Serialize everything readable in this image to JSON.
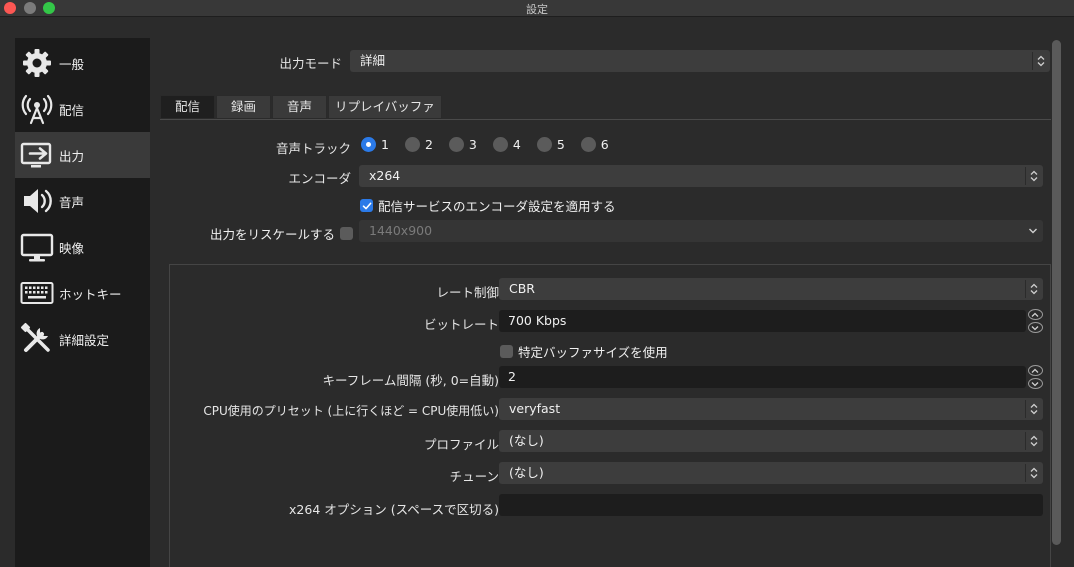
{
  "window": {
    "title": "設定"
  },
  "sidebar": {
    "items": [
      {
        "label": "一般",
        "icon": "gear-icon"
      },
      {
        "label": "配信",
        "icon": "broadcast-antenna-icon"
      },
      {
        "label": "出力",
        "icon": "output-monitor-icon",
        "active": true
      },
      {
        "label": "音声",
        "icon": "speaker-icon"
      },
      {
        "label": "映像",
        "icon": "monitor-icon"
      },
      {
        "label": "ホットキー",
        "icon": "keyboard-icon"
      },
      {
        "label": "詳細設定",
        "icon": "tools-icon"
      }
    ]
  },
  "output_mode": {
    "label": "出力モード",
    "value": "詳細"
  },
  "tabs": [
    {
      "label": "配信",
      "active": true
    },
    {
      "label": "録画"
    },
    {
      "label": "音声"
    },
    {
      "label": "リプレイバッファ"
    }
  ],
  "audio_track": {
    "label": "音声トラック",
    "options": [
      "1",
      "2",
      "3",
      "4",
      "5",
      "6"
    ],
    "selected": "1"
  },
  "encoder": {
    "label": "エンコーダ",
    "value": "x264"
  },
  "apply_service_settings": {
    "label": "配信サービスのエンコーダ設定を適用する",
    "checked": true
  },
  "rescale": {
    "label": "出力をリスケールする",
    "checked": false,
    "value": "1440x900"
  },
  "rate_control": {
    "label": "レート制御",
    "value": "CBR"
  },
  "bitrate": {
    "label": "ビットレート",
    "value": "700 Kbps"
  },
  "custom_buffer": {
    "label": "特定バッファサイズを使用",
    "checked": false
  },
  "keyframe": {
    "label": "キーフレーム間隔 (秒, 0=自動)",
    "value": "2"
  },
  "cpu_preset": {
    "label": "CPU使用のプリセット (上に行くほど = CPU使用低い)",
    "value": "veryfast"
  },
  "profile": {
    "label": "プロファイル",
    "value": "(なし)"
  },
  "tune": {
    "label": "チューン",
    "value": "(なし)"
  },
  "x264_options": {
    "label": "x264 オプション (スペースで区切る)",
    "value": ""
  },
  "colors": {
    "accent": "#2b7ae8",
    "background": "#2b2b2b",
    "sidebar": "#1b1b1b"
  }
}
